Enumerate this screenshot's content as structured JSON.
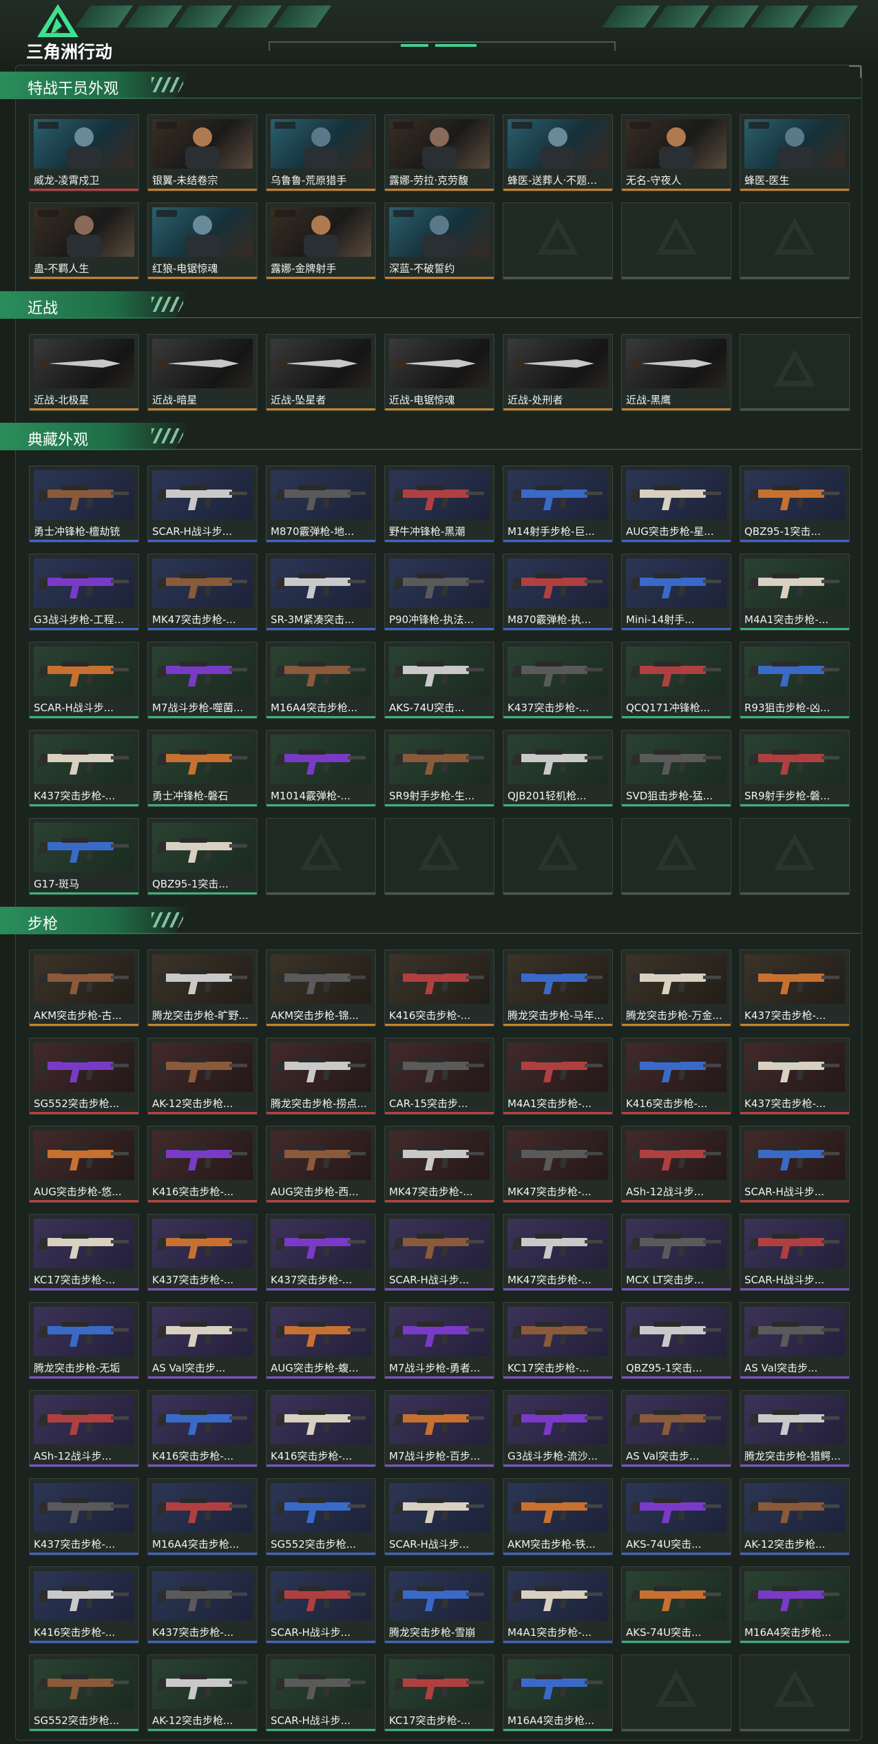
{
  "app": {
    "logo_text": "三角洲行动"
  },
  "sections": [
    {
      "id": "operator",
      "title": "特战干员外观",
      "items": [
        {
          "label": "威龙-凌霄戍卫",
          "rarity": "red"
        },
        {
          "label": "银翼-未结卷宗",
          "rarity": "gold"
        },
        {
          "label": "乌鲁鲁-荒原猎手",
          "rarity": "gold"
        },
        {
          "label": "露娜-劳拉·克劳馥",
          "rarity": "gold"
        },
        {
          "label": "蜂医-送葬人·不题…",
          "rarity": "gold"
        },
        {
          "label": "无名-守夜人",
          "rarity": "gold"
        },
        {
          "label": "蜂医-医生",
          "rarity": "gold"
        },
        {
          "label": "蛊-不羁人生",
          "rarity": "gold"
        },
        {
          "label": "红狼-电锯惊魂",
          "rarity": "gold"
        },
        {
          "label": "露娜-金牌射手",
          "rarity": "gold"
        },
        {
          "label": "深蓝-不破誓约",
          "rarity": "gold"
        }
      ],
      "empty_slots": 3
    },
    {
      "id": "melee",
      "title": "近战",
      "items": [
        {
          "label": "近战-北极星",
          "rarity": "gold"
        },
        {
          "label": "近战-暗星",
          "rarity": "gold"
        },
        {
          "label": "近战-坠星者",
          "rarity": "gold"
        },
        {
          "label": "近战-电锯惊魂",
          "rarity": "gold"
        },
        {
          "label": "近战-处刑者",
          "rarity": "gold"
        },
        {
          "label": "近战-黑鹰",
          "rarity": "gold"
        }
      ],
      "empty_slots": 1
    },
    {
      "id": "collection",
      "title": "典藏外观",
      "items": [
        {
          "label": "勇士冲锋枪-檀劫铳",
          "rarity": "blue"
        },
        {
          "label": "SCAR-H战斗步...",
          "rarity": "blue"
        },
        {
          "label": "M870霰弹枪-地...",
          "rarity": "blue"
        },
        {
          "label": "野牛冲锋枪-黑潮",
          "rarity": "blue"
        },
        {
          "label": "M14射手步枪-巨...",
          "rarity": "blue"
        },
        {
          "label": "AUG突击步枪-星...",
          "rarity": "blue"
        },
        {
          "label": "QBZ95-1突击...",
          "rarity": "blue"
        },
        {
          "label": "G3战斗步枪-工程...",
          "rarity": "blue"
        },
        {
          "label": "MK47突击步枪-...",
          "rarity": "blue"
        },
        {
          "label": "SR-3M紧凑突击...",
          "rarity": "blue"
        },
        {
          "label": "P90冲锋枪-执法...",
          "rarity": "blue"
        },
        {
          "label": "M870霰弹枪-执...",
          "rarity": "blue"
        },
        {
          "label": "Mini-14射手...",
          "rarity": "blue"
        },
        {
          "label": "M4A1突击步枪-...",
          "rarity": "green"
        },
        {
          "label": "SCAR-H战斗步...",
          "rarity": "green"
        },
        {
          "label": "M7战斗步枪-噬菌...",
          "rarity": "green"
        },
        {
          "label": "M16A4突击步枪...",
          "rarity": "green"
        },
        {
          "label": "AKS-74U突击...",
          "rarity": "green"
        },
        {
          "label": "K437突击步枪-...",
          "rarity": "green"
        },
        {
          "label": "QCQ171冲锋枪...",
          "rarity": "green"
        },
        {
          "label": "R93狙击步枪-凶...",
          "rarity": "green"
        },
        {
          "label": "K437突击步枪-...",
          "rarity": "green"
        },
        {
          "label": "勇士冲锋枪-磐石",
          "rarity": "green"
        },
        {
          "label": "M1014霰弹枪-...",
          "rarity": "green"
        },
        {
          "label": "SR9射手步枪-生...",
          "rarity": "green"
        },
        {
          "label": "QJB201轻机枪...",
          "rarity": "green"
        },
        {
          "label": "SVD狙击步枪-猛...",
          "rarity": "green"
        },
        {
          "label": "SR9射手步枪-磐...",
          "rarity": "green"
        },
        {
          "label": "G17-斑马",
          "rarity": "green"
        },
        {
          "label": "QBZ95-1突击...",
          "rarity": "green"
        }
      ],
      "empty_slots": 5
    },
    {
      "id": "rifle",
      "title": "步枪",
      "items": [
        {
          "label": "AKM突击步枪-古...",
          "rarity": "gold"
        },
        {
          "label": "腾龙突击步枪-旷野...",
          "rarity": "gold"
        },
        {
          "label": "AKM突击步枪-锦...",
          "rarity": "gold"
        },
        {
          "label": "K416突击步枪-...",
          "rarity": "gold"
        },
        {
          "label": "腾龙突击步枪-马年...",
          "rarity": "gold"
        },
        {
          "label": "腾龙突击步枪-万金...",
          "rarity": "gold"
        },
        {
          "label": "K437突击步枪-...",
          "rarity": "gold"
        },
        {
          "label": "SG552突击步枪...",
          "rarity": "red"
        },
        {
          "label": "AK-12突击步枪...",
          "rarity": "red"
        },
        {
          "label": "腾龙突击步枪-捞点...",
          "rarity": "red"
        },
        {
          "label": "CAR-15突击步...",
          "rarity": "red"
        },
        {
          "label": "M4A1突击步枪-...",
          "rarity": "red"
        },
        {
          "label": "K416突击步枪-...",
          "rarity": "red"
        },
        {
          "label": "K437突击步枪-...",
          "rarity": "red"
        },
        {
          "label": "AUG突击步枪-悠...",
          "rarity": "red"
        },
        {
          "label": "K416突击步枪-...",
          "rarity": "red"
        },
        {
          "label": "AUG突击步枪-西...",
          "rarity": "red"
        },
        {
          "label": "MK47突击步枪-...",
          "rarity": "red"
        },
        {
          "label": "MK47突击步枪-...",
          "rarity": "red"
        },
        {
          "label": "ASh-12战斗步...",
          "rarity": "red"
        },
        {
          "label": "SCAR-H战斗步...",
          "rarity": "red"
        },
        {
          "label": "KC17突击步枪-...",
          "rarity": "purple"
        },
        {
          "label": "K437突击步枪-...",
          "rarity": "purple"
        },
        {
          "label": "K437突击步枪-...",
          "rarity": "purple"
        },
        {
          "label": "SCAR-H战斗步...",
          "rarity": "purple"
        },
        {
          "label": "MK47突击步枪-...",
          "rarity": "purple"
        },
        {
          "label": "MCX LT突击步...",
          "rarity": "purple"
        },
        {
          "label": "SCAR-H战斗步...",
          "rarity": "purple"
        },
        {
          "label": "腾龙突击步枪-无垢",
          "rarity": "purple"
        },
        {
          "label": "AS Val突击步...",
          "rarity": "purple"
        },
        {
          "label": "AUG突击步枪-蝮...",
          "rarity": "purple"
        },
        {
          "label": "M7战斗步枪-勇者...",
          "rarity": "purple"
        },
        {
          "label": "KC17突击步枪-...",
          "rarity": "purple"
        },
        {
          "label": "QBZ95-1突击...",
          "rarity": "purple"
        },
        {
          "label": "AS Val突击步...",
          "rarity": "purple"
        },
        {
          "label": "ASh-12战斗步...",
          "rarity": "purple"
        },
        {
          "label": "K416突击步枪-...",
          "rarity": "purple"
        },
        {
          "label": "K416突击步枪-...",
          "rarity": "purple"
        },
        {
          "label": "M7战斗步枪-百步...",
          "rarity": "purple"
        },
        {
          "label": "G3战斗步枪-流沙...",
          "rarity": "purple"
        },
        {
          "label": "AS Val突击步...",
          "rarity": "purple"
        },
        {
          "label": "腾龙突击步枪-猎鳄...",
          "rarity": "purple"
        },
        {
          "label": "K437突击步枪-...",
          "rarity": "blue"
        },
        {
          "label": "M16A4突击步枪...",
          "rarity": "blue"
        },
        {
          "label": "SG552突击步枪...",
          "rarity": "blue"
        },
        {
          "label": "SCAR-H战斗步...",
          "rarity": "blue"
        },
        {
          "label": "AKM突击步枪-铁...",
          "rarity": "blue"
        },
        {
          "label": "AKS-74U突击...",
          "rarity": "blue"
        },
        {
          "label": "AK-12突击步枪...",
          "rarity": "blue"
        },
        {
          "label": "K416突击步枪-...",
          "rarity": "blue"
        },
        {
          "label": "K437突击步枪-...",
          "rarity": "blue"
        },
        {
          "label": "SCAR-H战斗步...",
          "rarity": "blue"
        },
        {
          "label": "腾龙突击步枪-雪崩",
          "rarity": "blue"
        },
        {
          "label": "M4A1突击步枪-...",
          "rarity": "blue"
        },
        {
          "label": "AKS-74U突击...",
          "rarity": "green"
        },
        {
          "label": "M16A4突击步枪...",
          "rarity": "green"
        },
        {
          "label": "SG552突击步枪...",
          "rarity": "green"
        },
        {
          "label": "AK-12突击步枪...",
          "rarity": "green"
        },
        {
          "label": "SCAR-H战斗步...",
          "rarity": "green"
        },
        {
          "label": "KC17突击步枪-...",
          "rarity": "green"
        },
        {
          "label": "M16A4突击步枪...",
          "rarity": "green"
        }
      ],
      "empty_slots": 2
    }
  ]
}
